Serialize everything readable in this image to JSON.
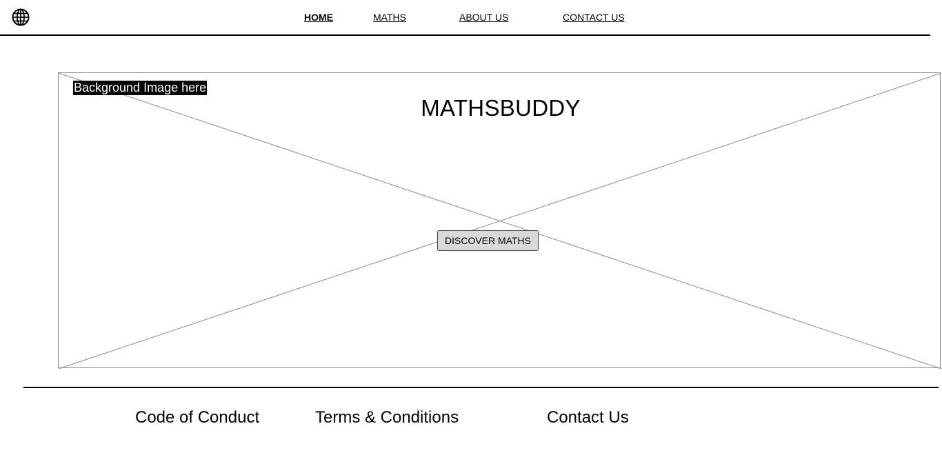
{
  "header": {
    "logo_icon": "globe-icon",
    "nav": [
      {
        "label": "HOME",
        "active": true
      },
      {
        "label": "MATHS",
        "active": false
      },
      {
        "label": "ABOUT US",
        "active": false
      },
      {
        "label": "CONTACT US",
        "active": false
      }
    ]
  },
  "hero": {
    "background_placeholder_label": "Background Image here",
    "title": "MATHSBUDDY",
    "cta_label": "DISCOVER MATHS"
  },
  "footer": {
    "links": [
      "Code of Conduct",
      "Terms & Conditions",
      "Contact Us"
    ]
  }
}
